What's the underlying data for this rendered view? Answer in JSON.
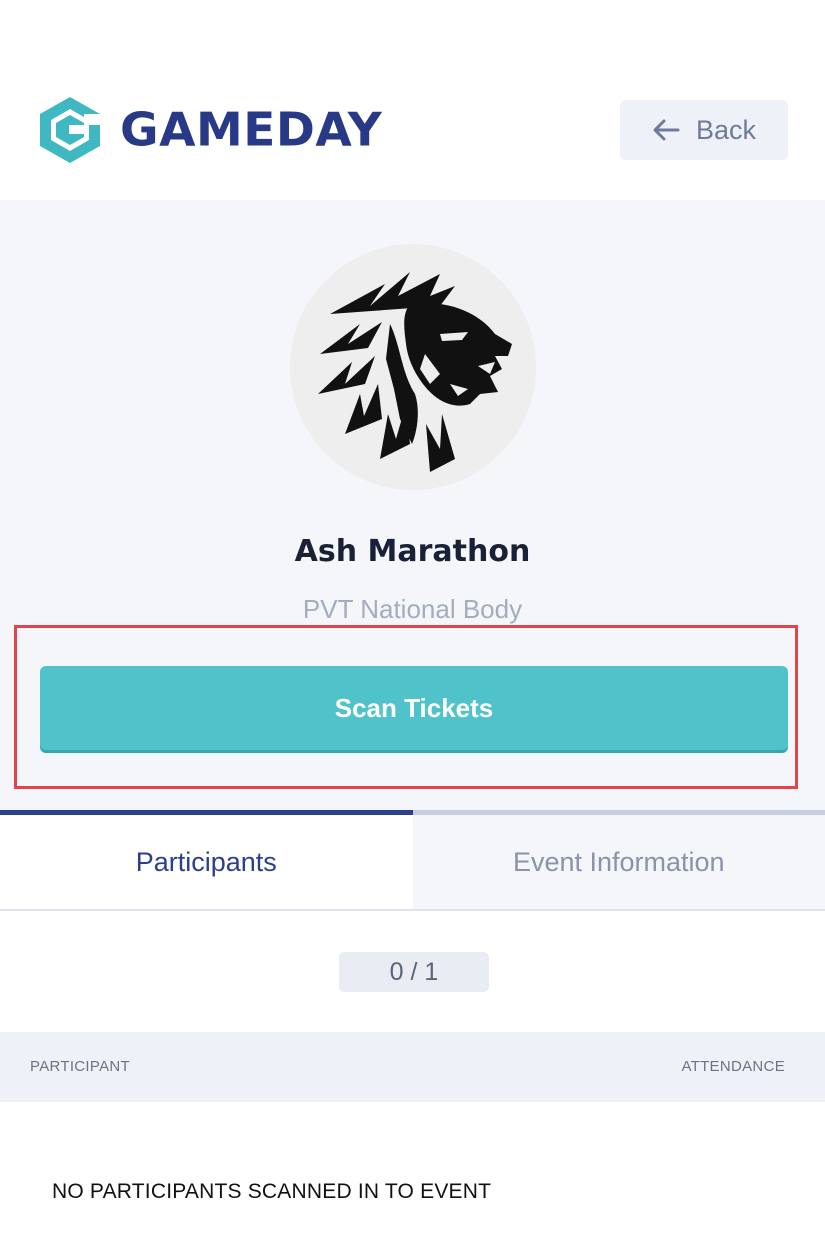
{
  "header": {
    "brand": "GAMEDAY",
    "back_label": "Back"
  },
  "event": {
    "title": "Ash Marathon",
    "organisation": "PVT National Body",
    "scan_label": "Scan Tickets"
  },
  "tabs": [
    {
      "label": "Participants",
      "active": true
    },
    {
      "label": "Event Information",
      "active": false
    }
  ],
  "participants": {
    "count": "0 / 1",
    "col_participant": "PARTICIPANT",
    "col_attendance": "ATTENDANCE",
    "empty_message": "NO PARTICIPANTS SCANNED IN TO EVENT"
  },
  "colors": {
    "brand_blue": "#283a87",
    "brand_teal": "#3fb8c1",
    "scan_button": "#4fc3c9",
    "highlight_border": "#e0454a"
  },
  "icons": [
    "gameday-logo-icon",
    "arrow-left-icon",
    "lion-logo-icon"
  ]
}
